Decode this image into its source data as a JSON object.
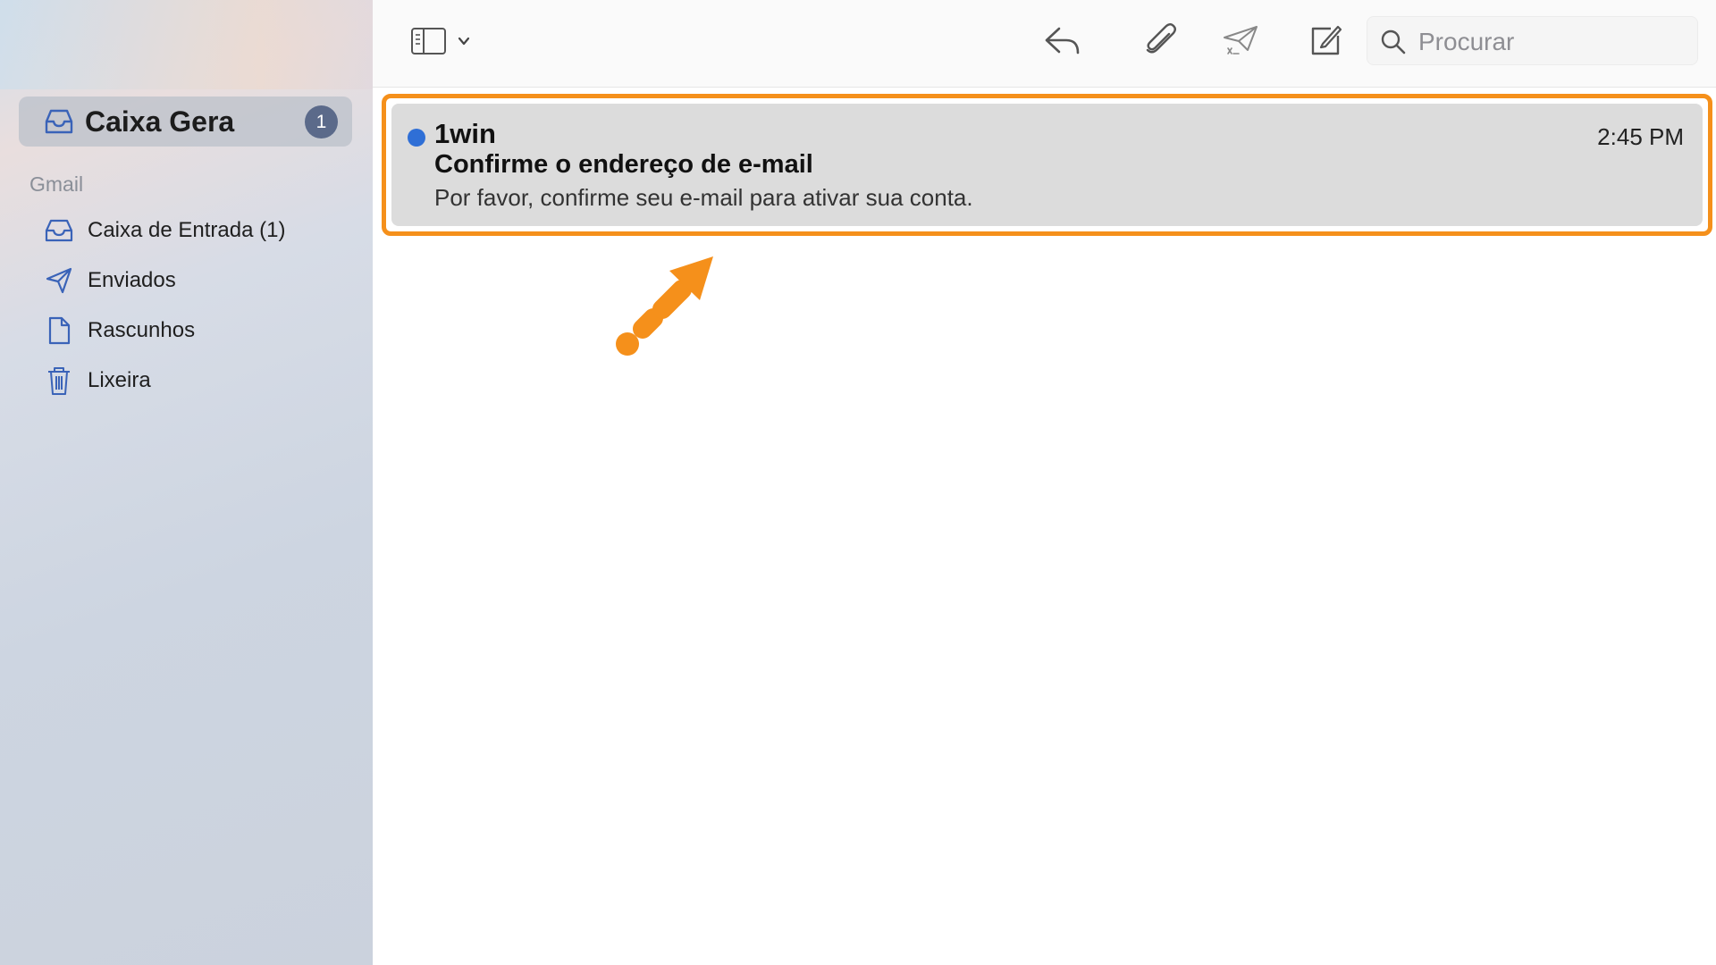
{
  "sidebar": {
    "top": {
      "label": "Caixa Gera",
      "badge": "1",
      "icon": "tray-icon"
    },
    "section_title": "Gmail",
    "items": [
      {
        "label": "Caixa de Entrada (1)",
        "icon": "inbox-tray-icon"
      },
      {
        "label": "Enviados",
        "icon": "paper-plane-icon"
      },
      {
        "label": "Rascunhos",
        "icon": "document-icon"
      },
      {
        "label": "Lixeira",
        "icon": "trash-icon"
      }
    ]
  },
  "toolbar": {
    "buttons": [
      "sidebar-toggle-icon",
      "reply-icon",
      "attachment-icon",
      "junk-icon",
      "compose-icon"
    ],
    "search": {
      "placeholder": "Procurar"
    }
  },
  "messages": [
    {
      "unread": true,
      "sender": "1win",
      "time": "2:45 PM",
      "subject": "Confirme o endereço de e-mail",
      "preview": "Por favor, confirme seu e-mail para ativar sua conta."
    }
  ],
  "colors": {
    "highlight": "#f5901b",
    "unread_dot": "#2f6fd6",
    "badge": "#5b6a8a"
  }
}
